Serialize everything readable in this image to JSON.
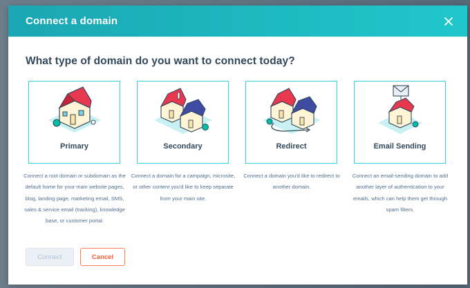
{
  "modal": {
    "title": "Connect a domain",
    "question": "What type of domain do you want to connect today?"
  },
  "options": [
    {
      "label": "Primary",
      "icon": "single-house-icon",
      "description": "Connect a root domain or subdomain as the default home for your main website pages, blog, landing page, marketing email, SMS, sales & service email (tracking), knowledge base, or customer portal."
    },
    {
      "label": "Secondary",
      "icon": "two-houses-icon",
      "description": "Connect a domain for a campaign, microsite, or other content you'd like to keep separate from your main site."
    },
    {
      "label": "Redirect",
      "icon": "redirect-houses-icon",
      "description": "Connect a domain you'd like to redirect to another domain."
    },
    {
      "label": "Email Sending",
      "icon": "house-envelope-icon",
      "description": "Connect an email-sending domain to add another layer of authentication to your emails, which can help them get through spam filters."
    }
  ],
  "footer": {
    "connect_label": "Connect",
    "cancel_label": "Cancel"
  },
  "colors": {
    "header_start": "#1aa6b3",
    "header_end": "#21c7cc",
    "card_border": "#33d1de",
    "roof_red": "#e8384f",
    "roof_blue": "#3f4ba1",
    "cancel_accent": "#ff5c35",
    "text_dark": "#33475b"
  }
}
